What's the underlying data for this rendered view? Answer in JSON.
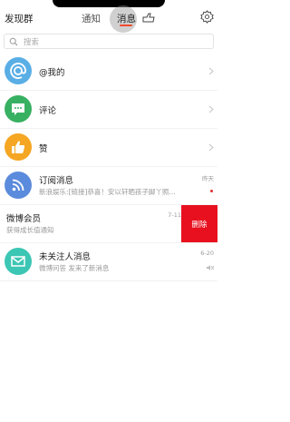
{
  "header": {
    "left_label": "发现群",
    "tabs": [
      {
        "label": "通知"
      },
      {
        "label": "消息"
      }
    ]
  },
  "search": {
    "placeholder": "搜索"
  },
  "rows": [
    {
      "title": "@我的",
      "icon": "at-icon",
      "color": "#5aaee6"
    },
    {
      "title": "评论",
      "icon": "comment-icon",
      "color": "#38b061"
    },
    {
      "title": "赞",
      "icon": "thumbs-up-icon",
      "color": "#f5a623"
    },
    {
      "title": "订阅消息",
      "subtitle": "新浪娱乐:[链接]恭喜！安以轩晒孩子脚丫照...",
      "time": "昨天",
      "icon": "rss-icon",
      "color": "#5b8bdc"
    },
    {
      "title": "微博会员",
      "subtitle": "获得成长值通知",
      "time": "7-11",
      "delete_label": "删除"
    },
    {
      "title": "未关注人消息",
      "subtitle": "微博问答 发来了新消息",
      "time": "6-20",
      "icon": "mail-icon",
      "color": "#3cc6b4"
    }
  ]
}
